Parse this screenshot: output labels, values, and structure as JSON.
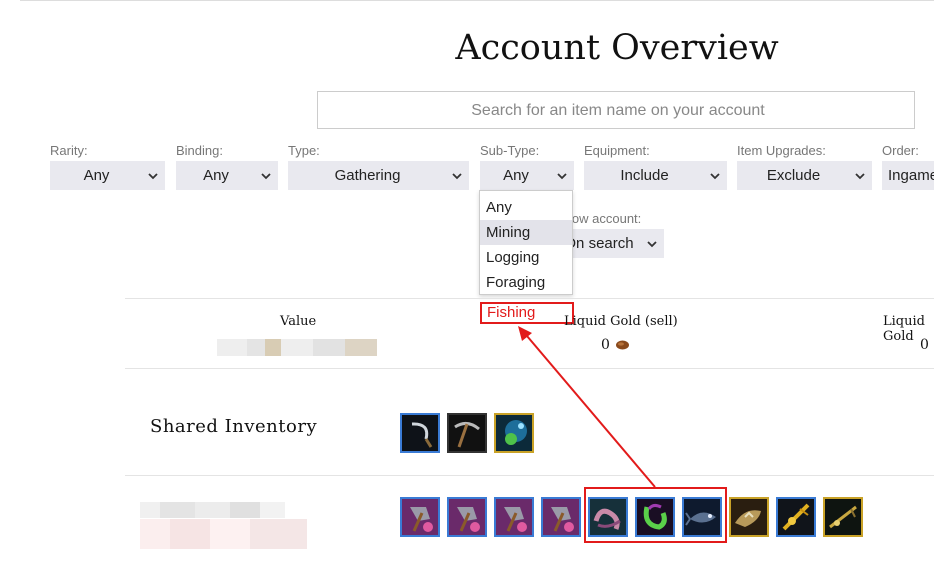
{
  "page": {
    "title": "Account Overview"
  },
  "search": {
    "placeholder": "Search for an item name on your account"
  },
  "filters": [
    {
      "label": "Rarity:",
      "value": "Any"
    },
    {
      "label": "Binding:",
      "value": "Any"
    },
    {
      "label": "Type:",
      "value": "Gathering"
    },
    {
      "label": "Sub-Type:",
      "value": "Any"
    },
    {
      "label": "Equipment:",
      "value": "Include"
    },
    {
      "label": "Item Upgrades:",
      "value": "Exclude"
    },
    {
      "label": "Order:",
      "value": "Ingame"
    }
  ],
  "show_account": {
    "label": "Show account:",
    "value": "On search"
  },
  "subtype_dropdown": {
    "options": [
      "Any",
      "Mining",
      "Logging",
      "Foraging",
      "Fishing"
    ],
    "highlighted": "Mining",
    "annotated": "Fishing"
  },
  "summary": {
    "value_label": "Value",
    "liquid_gold_sell_label": "Liquid Gold (sell)",
    "liquid_gold_sell_value": "0",
    "liquid_gold_buy_label": "Liquid Gold",
    "liquid_gold_buy_value": "0"
  },
  "shared_inventory": {
    "title": "Shared Inventory",
    "items": [
      {
        "icon": "sickle-icon",
        "rarity_color": "#3a7bd5"
      },
      {
        "icon": "pickaxe-icon",
        "rarity_color": "#333333"
      },
      {
        "icon": "harvesting-tool-icon",
        "rarity_color": "#c9a227"
      }
    ]
  },
  "character_row": {
    "items": [
      {
        "icon": "axe-icon",
        "rarity_color": "#3a7bd5"
      },
      {
        "icon": "axe-icon",
        "rarity_color": "#3a7bd5"
      },
      {
        "icon": "axe-icon",
        "rarity_color": "#3a7bd5"
      },
      {
        "icon": "axe-icon",
        "rarity_color": "#3a7bd5"
      },
      {
        "icon": "fishing-lure-icon",
        "rarity_color": "#3a7bd5"
      },
      {
        "icon": "fishing-lure-icon",
        "rarity_color": "#3a7bd5"
      },
      {
        "icon": "fishing-lure-icon",
        "rarity_color": "#3a7bd5"
      },
      {
        "icon": "fish-icon",
        "rarity_color": "#c9a227"
      },
      {
        "icon": "fishing-rod-icon",
        "rarity_color": "#3a7bd5"
      },
      {
        "icon": "fishing-rod-icon",
        "rarity_color": "#c9a227"
      }
    ]
  },
  "colors": {
    "annotation_red": "#e21b1b",
    "select_bg": "#e9e9ef"
  }
}
